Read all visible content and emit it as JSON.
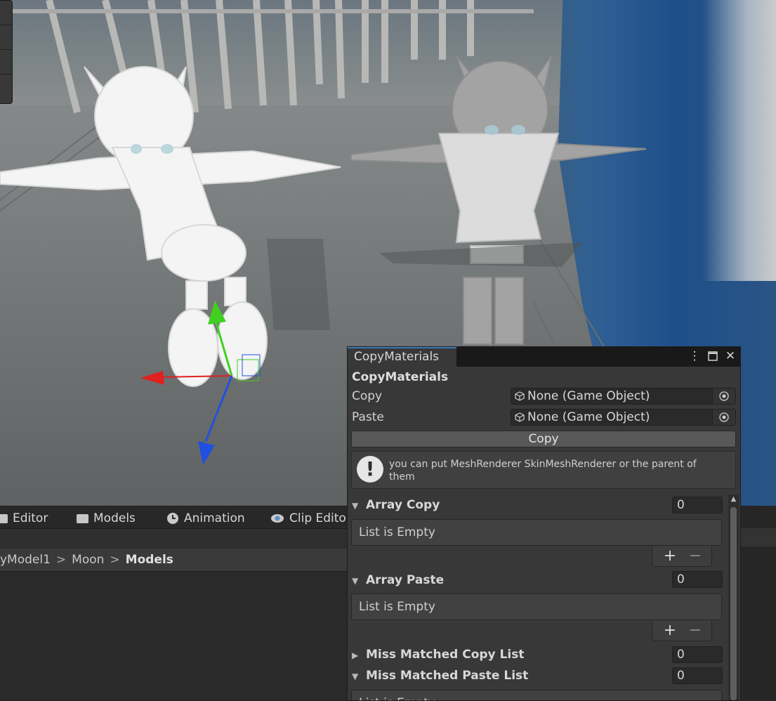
{
  "project_tabs": [
    {
      "label": "Editor",
      "icon": "folder-icon"
    },
    {
      "label": "Models",
      "icon": "folder-icon"
    },
    {
      "label": "Animation",
      "icon": "clock-icon"
    },
    {
      "label": "Clip Editor",
      "icon": "eye-icon"
    }
  ],
  "breadcrumb": {
    "items": [
      "yModel1",
      "Moon"
    ],
    "current": "Models",
    "separator": ">"
  },
  "window": {
    "tab_title": "CopyMaterials",
    "title": "CopyMaterials",
    "copy_label": "Copy",
    "copy_value": "None (Game Object)",
    "paste_label": "Paste",
    "paste_value": "None (Game Object)",
    "copy_button": "Copy",
    "help_message": "you can put MeshRenderer SkinMeshRenderer or the parent of them",
    "sections": [
      {
        "title": "Array Copy",
        "expanded": true,
        "count": "0",
        "empty_text": "List is Empty"
      },
      {
        "title": "Array Paste",
        "expanded": true,
        "count": "0",
        "empty_text": "List is Empty"
      },
      {
        "title": "Miss Matched Copy List",
        "expanded": false,
        "count": "0"
      },
      {
        "title": "Miss Matched Paste List",
        "expanded": true,
        "count": "0",
        "empty_text": "List is Empty"
      }
    ],
    "add_symbol": "+",
    "remove_symbol": "−",
    "expanded_glyph": "▼",
    "collapsed_glyph": "▶"
  },
  "colors": {
    "panel_bg": "#383838",
    "tab_accent": "#3a79bb",
    "gizmo_x": "#e02020",
    "gizmo_y": "#40d020",
    "gizmo_z": "#2050e0"
  }
}
